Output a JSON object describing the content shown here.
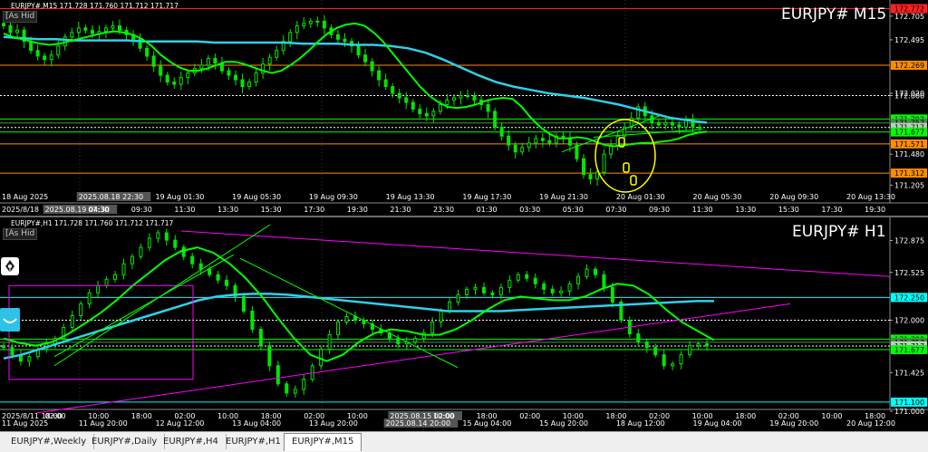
{
  "colors": {
    "bg": "#000000",
    "grid": "#3a3a3a",
    "candle": "#00e600",
    "ma_fast": "#00ff00",
    "ma_slow": "#2fd0e8",
    "trend": "#ff00ff",
    "orange": "#ff8c00",
    "yellow_annot": "#ffff00",
    "green_level": "#00ff00",
    "cyan_level": "#00ffff",
    "red_level": "#ff2020"
  },
  "icons": [
    "fountain-pen-icon",
    "smile-wave-icon"
  ],
  "top": {
    "symbol_info": "EURJPY#,M15  171.728 171.760 171.712 171.717",
    "title": "EURJPY# M15",
    "as_hide": "[As Hid",
    "price_labels": [
      "172.772",
      "172.705",
      "172.495",
      "172.269",
      "172.020",
      "172.000",
      "171.792",
      "171.757",
      "171.717",
      "171.677",
      "171.571",
      "171.480",
      "171.312",
      "171.205"
    ],
    "time_labels": [
      "2025/8/18",
      "2025.08.19 04:30",
      "07:30",
      "09:30",
      "11:30",
      "13:30",
      "15:30",
      "17:30",
      "19:30",
      "21:30",
      "23:30",
      "01:30",
      "03:30",
      "05:30",
      "07:30",
      "09:30",
      "11:30",
      "13:30",
      "15:30",
      "17:30",
      "19:30"
    ],
    "date_labels": [
      "18 Aug 2025",
      "2025.08.18 22:30",
      "19 Aug 01:30",
      "19 Aug 05:30",
      "19 Aug 09:30",
      "19 Aug 13:30",
      "19 Aug 17:30",
      "19 Aug 21:30",
      "20 Aug 01:30",
      "20 Aug 05:30",
      "20 Aug 09:30",
      "20 Aug 13:30"
    ]
  },
  "bottom": {
    "symbol_info": "EURJPY#,H1  171.728 171.760 171.712 171.717",
    "title": "EURJPY# H1",
    "as_hide": "[As Hid",
    "price_labels": [
      "172.875",
      "172.525",
      "172.250",
      "172.000",
      "171.792",
      "171.757",
      "171.717",
      "171.677",
      "171.425",
      "171.100",
      "171.000"
    ],
    "time_labels": [
      "2025/8/11 18:00",
      "02:00",
      "10:00",
      "18:00",
      "02:00",
      "10:00",
      "18:00",
      "02:00",
      "10:00",
      "2025.08.15 02:00",
      "10:00",
      "18:00",
      "02:00",
      "10:00",
      "18:00",
      "02:00",
      "10:00",
      "18:00",
      "02:00",
      "10:00",
      "18:00"
    ],
    "date_labels": [
      "11 Aug 2025",
      "11 Aug 20:00",
      "12 Aug 12:00",
      "13 Aug 04:00",
      "13 Aug 20:00",
      "2025.08.14 20:00",
      "15 Aug 04:00",
      "15 Aug 20:00",
      "18 Aug 12:00",
      "19 Aug 04:00",
      "19 Aug 20:00",
      "20 Aug 12:00"
    ]
  },
  "tabs": [
    {
      "label": "EURJPY#,Weekly",
      "active": false
    },
    {
      "label": "EURJPY#,Daily",
      "active": false
    },
    {
      "label": "EURJPY#,H4",
      "active": false
    },
    {
      "label": "EURJPY#,H1",
      "active": false
    },
    {
      "label": "EURJPY#,M15",
      "active": true
    }
  ],
  "chart_data": [
    {
      "type": "candlestick",
      "title": "EURJPY# M15",
      "ylim": [
        171.16,
        172.8
      ],
      "grid": true,
      "close_series": [
        172.62,
        172.56,
        172.58,
        172.48,
        172.4,
        172.35,
        172.32,
        172.36,
        172.44,
        172.52,
        172.56,
        172.6,
        172.58,
        172.55,
        172.57,
        172.6,
        172.62,
        172.58,
        172.54,
        172.5,
        172.42,
        172.35,
        172.26,
        172.18,
        172.12,
        172.1,
        172.16,
        172.2,
        172.24,
        172.27,
        172.33,
        172.29,
        172.22,
        172.18,
        172.14,
        172.08,
        172.12,
        172.2,
        172.28,
        172.34,
        172.4,
        172.48,
        172.56,
        172.62,
        172.64,
        172.66,
        172.66,
        172.6,
        172.54,
        172.5,
        172.48,
        172.44,
        172.36,
        172.3,
        172.22,
        172.14,
        172.08,
        172.02,
        171.98,
        171.94,
        171.88,
        171.84,
        171.82,
        171.86,
        171.92,
        171.96,
        171.98,
        172.0,
        172.0,
        171.96,
        171.92,
        171.86,
        171.72,
        171.64,
        171.56,
        171.5,
        171.54,
        171.58,
        171.62,
        171.6,
        171.58,
        171.64,
        171.62,
        171.56,
        171.44,
        171.3,
        171.26,
        171.32,
        171.48,
        171.56,
        171.64,
        171.72,
        171.8,
        171.9,
        171.82,
        171.76,
        171.74,
        171.76,
        171.74,
        171.72,
        171.78,
        171.72,
        171.717
      ],
      "ma_fast_y": [
        172.55,
        172.52,
        172.5,
        172.48,
        172.46,
        172.45,
        172.46,
        172.48,
        172.5,
        172.52,
        172.54,
        172.56,
        172.57,
        172.56,
        172.54,
        172.5,
        172.44,
        172.36,
        172.3,
        172.25,
        172.22,
        172.22,
        172.24,
        172.27,
        172.3,
        172.3,
        172.28,
        172.25,
        172.22,
        172.2,
        172.22,
        172.27,
        172.33,
        172.4,
        172.48,
        172.55,
        172.6,
        172.63,
        172.64,
        172.62,
        172.56,
        172.48,
        172.38,
        172.28,
        172.18,
        172.08,
        172.0,
        171.94,
        171.9,
        171.89,
        171.9,
        171.92,
        171.95,
        171.97,
        171.98,
        171.97,
        171.9,
        171.8,
        171.72,
        171.66,
        171.62,
        171.62,
        171.63,
        171.62,
        171.59,
        171.56,
        171.55,
        171.56,
        171.57,
        171.58,
        171.58,
        171.59,
        171.6,
        171.62,
        171.65,
        171.67,
        171.68
      ],
      "ma_slow_y": [
        172.52,
        172.51,
        172.5,
        172.5,
        172.49,
        172.49,
        172.49,
        172.49,
        172.48,
        172.48,
        172.48,
        172.48,
        172.47,
        172.47,
        172.47,
        172.47,
        172.47,
        172.46,
        172.46,
        172.46,
        172.45,
        172.45,
        172.44,
        172.42,
        172.38,
        172.32,
        172.25,
        172.18,
        172.12,
        172.08,
        172.05,
        172.02,
        172.0,
        171.98,
        171.95,
        171.92,
        171.88,
        171.84,
        171.8,
        171.78,
        171.76
      ],
      "levels": [
        {
          "price": 172.772,
          "kind": "red"
        },
        {
          "price": 172.269,
          "kind": "orange"
        },
        {
          "price": 172.0,
          "kind": "dotted"
        },
        {
          "price": 171.792,
          "kind": "green"
        },
        {
          "price": 171.757,
          "kind": "green-dark"
        },
        {
          "price": 171.717,
          "kind": "bid"
        },
        {
          "price": 171.677,
          "kind": "green"
        },
        {
          "price": 171.571,
          "kind": "orange"
        },
        {
          "price": 171.312,
          "kind": "orange"
        }
      ]
    },
    {
      "type": "candlestick",
      "title": "EURJPY# H1",
      "ylim": [
        170.96,
        173.05
      ],
      "grid": true,
      "close_series": [
        171.7,
        171.62,
        171.55,
        171.6,
        171.68,
        171.74,
        171.8,
        171.92,
        172.05,
        172.18,
        172.3,
        172.38,
        172.45,
        172.5,
        172.62,
        172.7,
        172.8,
        172.9,
        172.96,
        172.88,
        172.8,
        172.7,
        172.62,
        172.56,
        172.5,
        172.44,
        172.38,
        172.26,
        172.1,
        171.9,
        171.72,
        171.5,
        171.3,
        171.2,
        171.24,
        171.35,
        171.5,
        171.68,
        171.84,
        171.98,
        172.04,
        172.0,
        171.96,
        171.9,
        171.86,
        171.8,
        171.74,
        171.76,
        171.8,
        171.86,
        171.98,
        172.1,
        172.2,
        172.28,
        172.34,
        172.36,
        172.3,
        172.28,
        172.36,
        172.44,
        172.5,
        172.46,
        172.4,
        172.34,
        172.3,
        172.32,
        172.4,
        172.48,
        172.56,
        172.5,
        172.36,
        172.2,
        172.0,
        171.85,
        171.76,
        171.7,
        171.62,
        171.5,
        171.52,
        171.62,
        171.72,
        171.74,
        171.717
      ],
      "ma_fast_y": [
        171.8,
        171.75,
        171.72,
        171.76,
        171.85,
        171.96,
        172.08,
        172.22,
        172.38,
        172.52,
        172.66,
        172.76,
        172.8,
        172.74,
        172.62,
        172.46,
        172.26,
        172.02,
        171.8,
        171.62,
        171.55,
        171.62,
        171.76,
        171.86,
        171.9,
        171.88,
        171.84,
        171.84,
        171.9,
        172.0,
        172.12,
        172.22,
        172.26,
        172.24,
        172.22,
        172.22,
        172.26,
        172.34,
        172.4,
        172.38,
        172.28,
        172.12,
        171.98,
        171.88,
        171.78
      ],
      "ma_slow_y": [
        171.58,
        171.62,
        171.68,
        171.74,
        171.8,
        171.86,
        171.92,
        171.98,
        172.04,
        172.1,
        172.16,
        172.22,
        172.26,
        172.28,
        172.29,
        172.29,
        172.28,
        172.26,
        172.24,
        172.22,
        172.2,
        172.18,
        172.16,
        172.14,
        172.12,
        172.1,
        172.1,
        172.1,
        172.1,
        172.11,
        172.12,
        172.13,
        172.14,
        172.15,
        172.16,
        172.17,
        172.18,
        172.19,
        172.2,
        172.21,
        172.21
      ],
      "levels": [
        {
          "price": 172.25,
          "kind": "cyan"
        },
        {
          "price": 172.0,
          "kind": "dotted"
        },
        {
          "price": 171.792,
          "kind": "green"
        },
        {
          "price": 171.757,
          "kind": "green-dark"
        },
        {
          "price": 171.717,
          "kind": "bid"
        },
        {
          "price": 171.677,
          "kind": "green"
        },
        {
          "price": 171.1,
          "kind": "cyan"
        }
      ]
    }
  ]
}
